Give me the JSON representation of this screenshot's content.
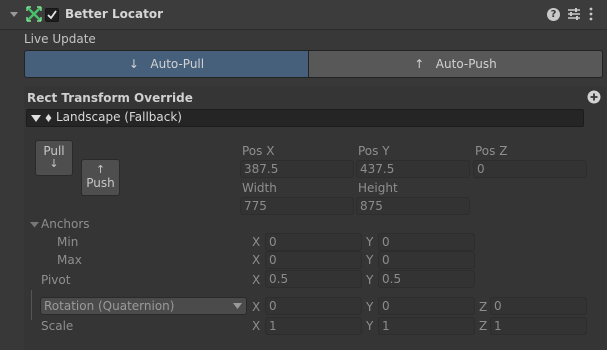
{
  "header": {
    "title": "Better Locator",
    "enabled": true,
    "help_icon": "help-icon",
    "settings_icon": "sliders-icon",
    "menu_icon": "kebab-menu-icon"
  },
  "live_update": {
    "label": "Live Update",
    "options": [
      {
        "label": "Auto-Pull",
        "arrow": "↓",
        "selected": true
      },
      {
        "label": "Auto-Push",
        "arrow": "↑",
        "selected": false
      }
    ]
  },
  "override": {
    "title": "Rect Transform Override",
    "add_icon": "plus-circle-icon",
    "config_label": "Landscape (Fallback)"
  },
  "buttons": {
    "pull_label": "Pull",
    "pull_arrow": "↓",
    "push_label": "Push",
    "push_arrow": "↑"
  },
  "transform": {
    "pos_x_label": "Pos X",
    "pos_x": "387.5",
    "pos_y_label": "Pos Y",
    "pos_y": "437.5",
    "pos_z_label": "Pos Z",
    "pos_z": "0",
    "width_label": "Width",
    "width": "775",
    "height_label": "Height",
    "height": "875"
  },
  "anchors": {
    "label": "Anchors",
    "min_label": "Min",
    "min_x": "0",
    "min_y": "0",
    "max_label": "Max",
    "max_x": "0",
    "max_y": "0"
  },
  "pivot": {
    "label": "Pivot",
    "x": "0.5",
    "y": "0.5"
  },
  "rotation": {
    "mode": "Rotation (Quaternion)",
    "x": "0",
    "y": "0",
    "z": "0"
  },
  "scale": {
    "label": "Scale",
    "x": "1",
    "y": "1",
    "z": "1"
  },
  "axis": {
    "x": "X",
    "y": "Y",
    "z": "Z"
  },
  "colors": {
    "selected_segment": "#46607c",
    "unselected_segment": "#585858",
    "panel": "#383838"
  }
}
